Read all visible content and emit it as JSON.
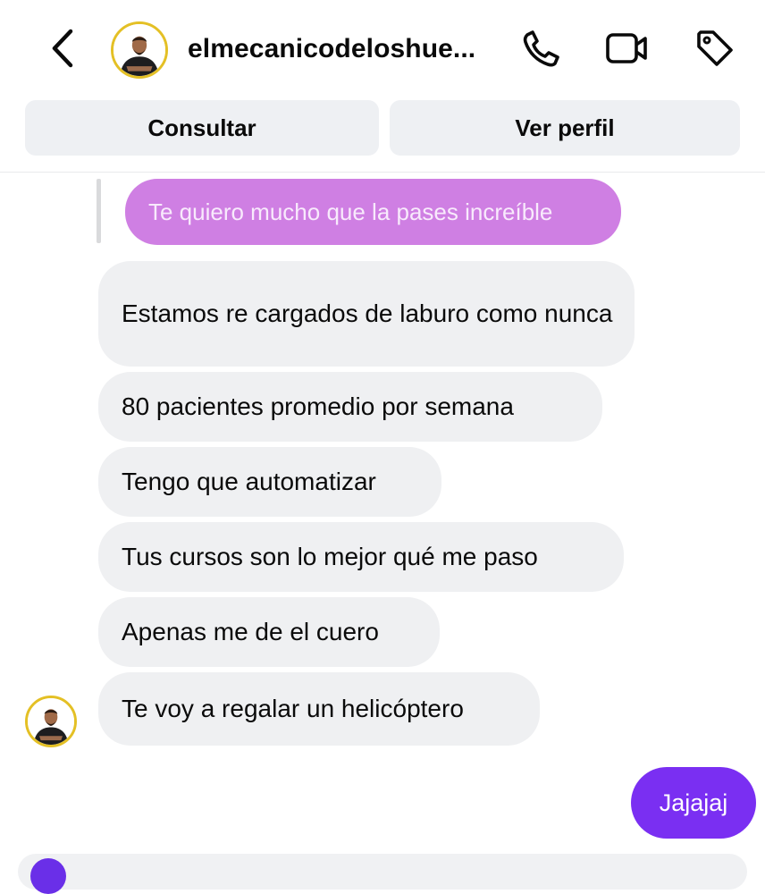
{
  "header": {
    "back_icon": "chevron-left-icon",
    "username": "elmecanicodeloshue...",
    "call_icon": "phone-icon",
    "video_icon": "video-camera-icon",
    "tag_icon": "tag-icon"
  },
  "actions": {
    "consult_label": "Consultar",
    "profile_label": "Ver perfil"
  },
  "messages": {
    "replied": "Te quiero mucho que la pases increíble",
    "received": [
      "Estamos re cargados de laburo como nunca",
      "80 pacientes promedio por semana",
      "Tengo que automatizar",
      "Tus cursos son lo mejor qué me paso",
      "Apenas me de el cuero",
      "Te voy a regalar un helicóptero"
    ],
    "sent": "Jajajaj"
  },
  "colors": {
    "sent_bubble": "#7a2ff2",
    "reply_bubble": "#cf7fe3",
    "received_bubble": "#eff0f2",
    "avatar_ring": "#e4c025"
  }
}
